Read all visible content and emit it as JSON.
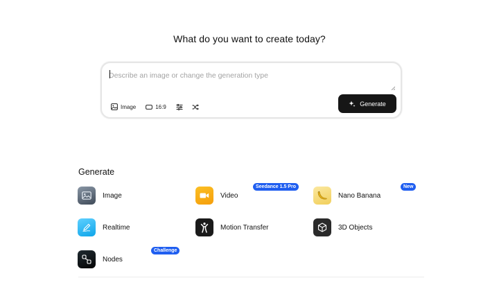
{
  "headline": "What do you want to create today?",
  "prompt": {
    "placeholder": "Describe an image or change the generation type",
    "value": ""
  },
  "toolbar": {
    "mode_label": "Image",
    "aspect_label": "16:9",
    "settings_icon": "sliders-icon",
    "shuffle_icon": "shuffle-icon",
    "generate_label": "Generate"
  },
  "generate_section": {
    "title": "Generate",
    "items": [
      {
        "label": "Image",
        "badge": "",
        "icon": "image-icon",
        "color": "#5f6b7a"
      },
      {
        "label": "Video",
        "badge": "Seedance 1.5 Pro",
        "icon": "video-icon",
        "color": "#f59e0b"
      },
      {
        "label": "Nano Banana",
        "badge": "New",
        "icon": "banana-icon",
        "color": "#f6dc7a"
      },
      {
        "label": "Realtime",
        "badge": "",
        "icon": "pen-icon",
        "color": "#38bdf8"
      },
      {
        "label": "Motion Transfer",
        "badge": "",
        "icon": "figure-icon",
        "color": "#1a1a1a"
      },
      {
        "label": "3D Objects",
        "badge": "",
        "icon": "cube-icon",
        "color": "#2a2a2a"
      },
      {
        "label": "Nodes",
        "badge": "Challenge",
        "icon": "nodes-icon",
        "color": "#111111"
      }
    ]
  },
  "colors": {
    "accent_badge": "#1f5ef0",
    "button_dark": "#161616"
  }
}
